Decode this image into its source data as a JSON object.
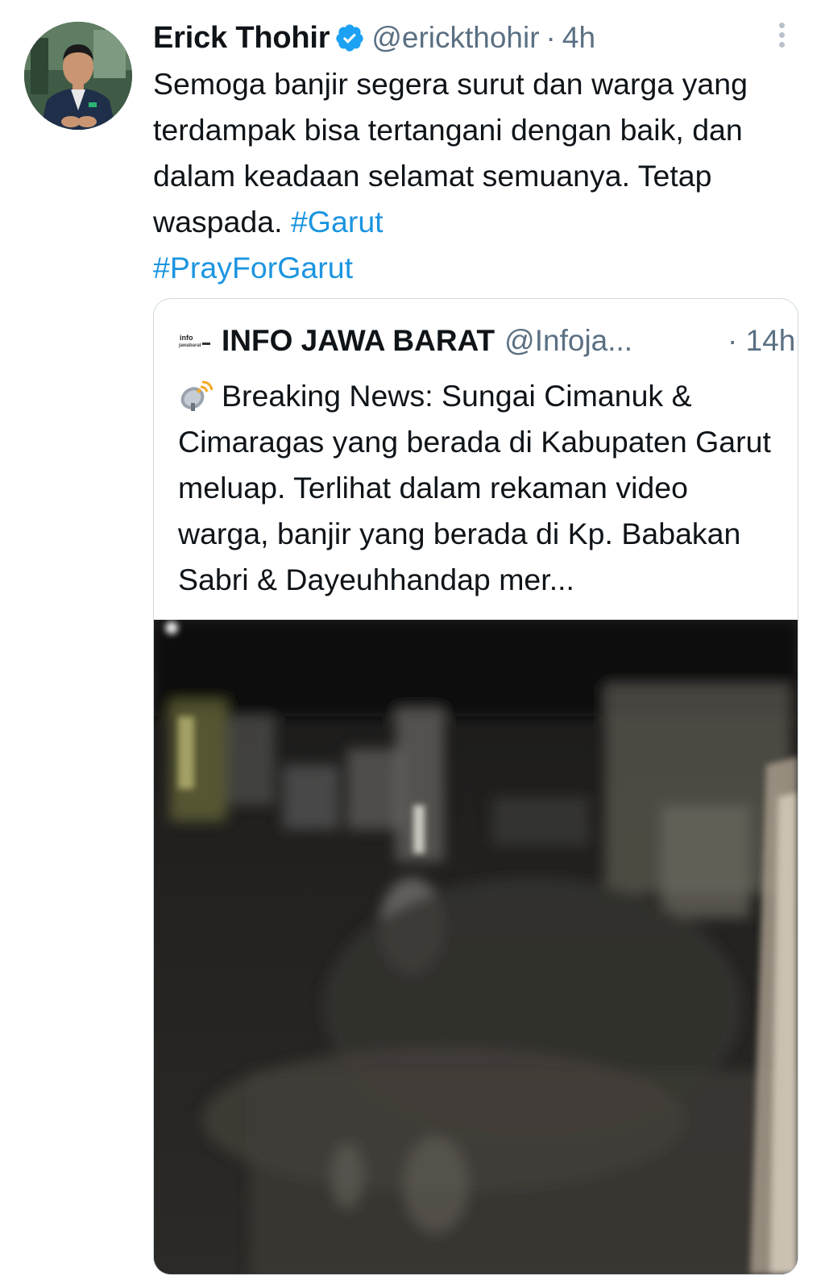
{
  "tweet": {
    "author": {
      "display_name": "Erick Thohir",
      "handle": "@erickthohir",
      "verified": true,
      "avatar_icon": "profile-photo"
    },
    "separator": "·",
    "time": "4h",
    "more_icon": "vertical-ellipsis-icon",
    "text_plain": "Semoga banjir segera surut dan warga yang terdampak bisa tertangani dengan baik, dan dalam keadaan selamat semuanya. Tetap waspada. ",
    "hashtags": [
      "#Garut",
      "#PrayForGarut"
    ]
  },
  "quoted_tweet": {
    "author": {
      "display_name": "INFO JAWA BARAT",
      "handle": "@Infoja...",
      "avatar_icon": "infojawabarat-logo",
      "logo_text": "info jawabarat"
    },
    "separator": "·",
    "time": "14h",
    "emoji_icon": "satellite-antenna-icon",
    "text": "Breaking News: Sungai Cimanuk & Cimaragas yang berada di Kabupaten Garut meluap. Terlihat dalam rekaman video warga, banjir yang berada di Kp. Babakan Sabri & Dayeuhhandap mer...",
    "media": {
      "type": "video-frame",
      "description_icon": "video-thumbnail"
    }
  },
  "colors": {
    "link": "#1b95e0",
    "secondary_text": "#5b7083",
    "verified_badge": "#1da1f2",
    "border": "#cfd9de"
  }
}
